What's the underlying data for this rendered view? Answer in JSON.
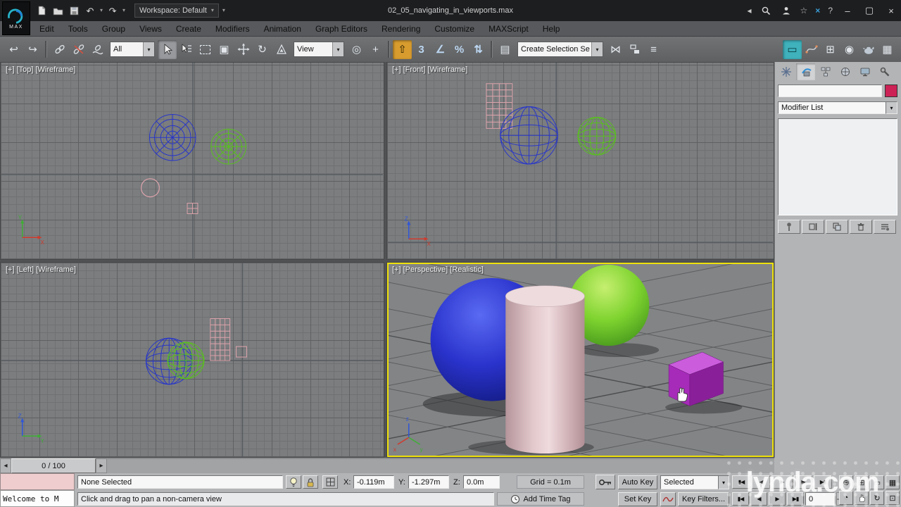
{
  "colors": {
    "object_blue": "#2836c8",
    "object_green": "#58c21c",
    "object_pink": "#dca3ab",
    "object_purple": "#a62bb9",
    "active_viewport_border": "#efe10a",
    "swatch_red": "#cc2255",
    "axis_x": "#d03a2c",
    "axis_y": "#3fae35",
    "axis_z": "#2f55d8"
  },
  "titlebar": {
    "logo": "MAX",
    "workspace": "Workspace: Default",
    "title": "02_05_navigating_in_viewports.max"
  },
  "menubar": {
    "items": [
      "Edit",
      "Tools",
      "Group",
      "Views",
      "Create",
      "Modifiers",
      "Animation",
      "Graph Editors",
      "Rendering",
      "Customize",
      "MAXScript",
      "Help"
    ]
  },
  "toolbar": {
    "filter_value": "All",
    "coord_value": "View",
    "selset_value": "Create Selection Se"
  },
  "viewports": {
    "top_label": "[+] [Top] [Wireframe]",
    "front_label": "[+] [Front] [Wireframe]",
    "left_label": "[+] [Left] [Wireframe]",
    "persp_label": "[+] [Perspective] [Realistic]"
  },
  "panel": {
    "modifier_list": "Modifier List",
    "name_value": ""
  },
  "trackbar": {
    "time": "0 / 100"
  },
  "status": {
    "selection": "None Selected",
    "x_label": "X:",
    "x_value": "-0.119m",
    "y_label": "Y:",
    "y_value": "-1.297m",
    "z_label": "Z:",
    "z_value": "0.0m",
    "grid_label": "Grid = 0.1m",
    "prompt": "Click and drag to pan a non-camera view",
    "time_tag": "Add Time Tag",
    "listener_text": "Welcome to M"
  },
  "anim": {
    "auto_key": "Auto Key",
    "set_key": "Set Key",
    "selected": "Selected",
    "key_filters": "Key Filters...",
    "frame_value": "0"
  },
  "icons": {
    "dd": "▾",
    "undo": "↶",
    "redo": "↷",
    "back": "◂",
    "star": "☆",
    "help": "?",
    "xbadge": "×",
    "min": "–",
    "max": "▢",
    "close": "×",
    "tb_undo": "↩",
    "tb_redo": "↪",
    "rotate": "↻",
    "wincross": "▣",
    "pivot": "◎",
    "manip": "+",
    "kbd": "⇧",
    "snap3": "3",
    "angle": "∠",
    "percent": "%",
    "spinner": "⇅",
    "sets": "▤",
    "mirror": "⋈",
    "layers": "≡",
    "ribbon": "▭",
    "schematic": "⊞",
    "material": "◉",
    "framewin": "▦",
    "trk_l": "◂",
    "trk_r": "▸",
    "t_start": "▮◀",
    "t_prev": "◀",
    "t_play": "▶",
    "t_next": "▶",
    "t_end": "▶▮",
    "s_start": "▮◀",
    "s_prev": "◀",
    "s_next": "▶",
    "s_end": "▶▮",
    "nav_zoom": "⊕",
    "nav_all": "⊞",
    "nav_ext": "▭",
    "nav_extall": "▦",
    "nav_fov": "◔",
    "nav_orbit": "↻",
    "nav_max": "⊡",
    "spin_up": "▴",
    "spin_dn": "▾"
  },
  "watermark": "lynda.com"
}
